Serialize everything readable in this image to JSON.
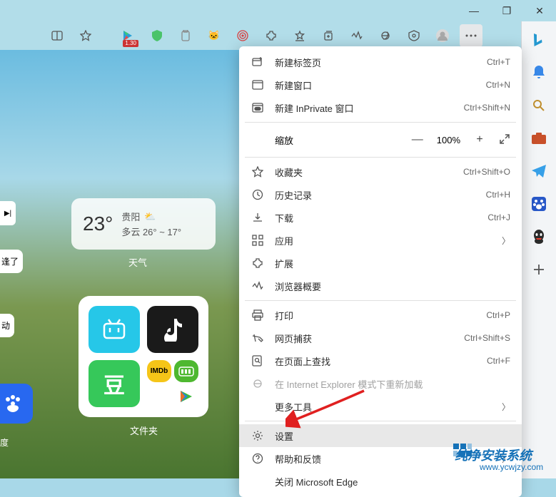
{
  "window_controls": {
    "min": "—",
    "max": "❐",
    "close": "✕"
  },
  "toolbar_badge": "1.30",
  "menu": {
    "new_tab": "新建标签页",
    "new_tab_key": "Ctrl+T",
    "new_window": "新建窗口",
    "new_window_key": "Ctrl+N",
    "new_inprivate": "新建 InPrivate 窗口",
    "new_inprivate_key": "Ctrl+Shift+N",
    "zoom_label": "缩放",
    "zoom_value": "100%",
    "favorites": "收藏夹",
    "favorites_key": "Ctrl+Shift+O",
    "history": "历史记录",
    "history_key": "Ctrl+H",
    "downloads": "下载",
    "downloads_key": "Ctrl+J",
    "apps": "应用",
    "extensions": "扩展",
    "essentials": "浏览器概要",
    "print": "打印",
    "print_key": "Ctrl+P",
    "capture": "网页捕获",
    "capture_key": "Ctrl+Shift+S",
    "find": "在页面上查找",
    "find_key": "Ctrl+F",
    "ie_mode": "在 Internet Explorer 模式下重新加载",
    "more_tools": "更多工具",
    "settings": "设置",
    "help": "帮助和反馈",
    "close_edge": "关闭 Microsoft Edge"
  },
  "weather": {
    "temp": "23°",
    "city": "贵阳",
    "range": "多云 26° ~ 17°",
    "label": "天气"
  },
  "folder": {
    "imdb": "IMDb",
    "douban": "豆",
    "label": "文件夹"
  },
  "left_cut": {
    "a": "逢了",
    "b": "动",
    "c": "度"
  },
  "watermark": {
    "name": "纯净安装系统",
    "url": "www.ycwjzy.com"
  }
}
